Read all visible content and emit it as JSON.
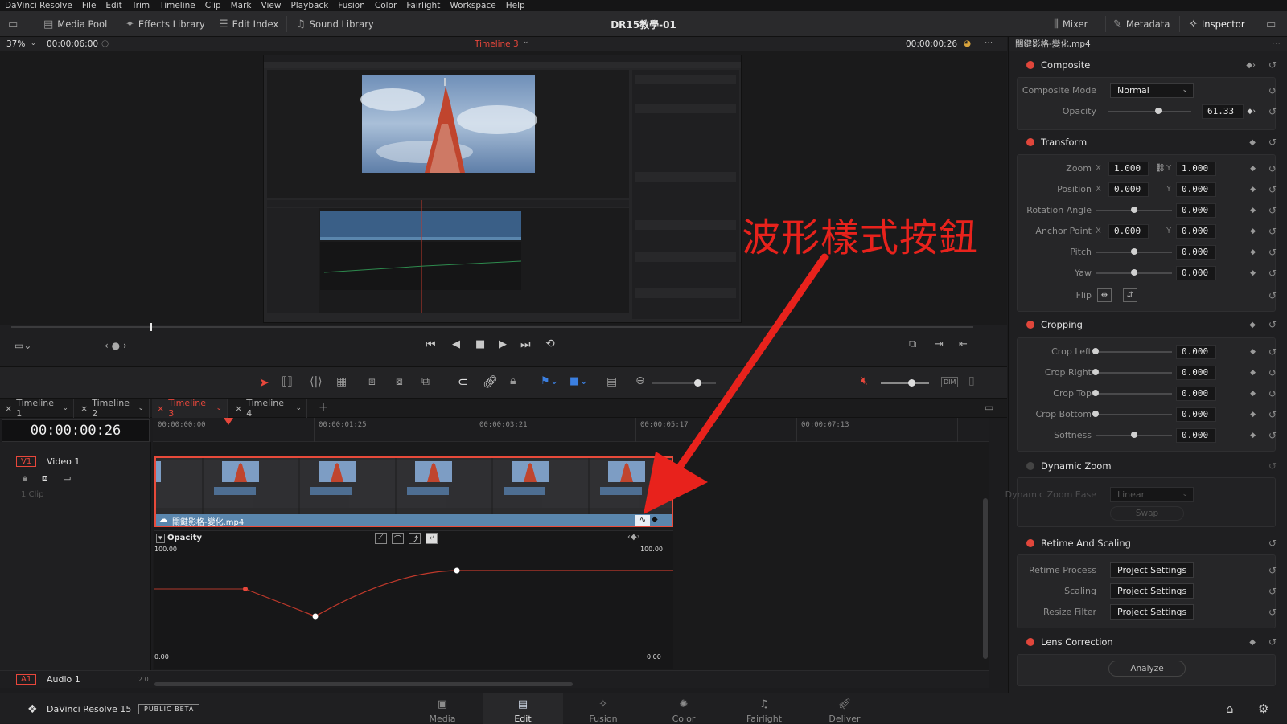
{
  "menubar": {
    "app": "DaVinci Resolve",
    "items": [
      "File",
      "Edit",
      "Trim",
      "Timeline",
      "Clip",
      "Mark",
      "View",
      "Playback",
      "Fusion",
      "Color",
      "Fairlight",
      "Workspace",
      "Help"
    ]
  },
  "toolbar": {
    "media_pool": "Media Pool",
    "effects_library": "Effects Library",
    "edit_index": "Edit Index",
    "sound_library": "Sound Library",
    "project_title": "DR15教學-01",
    "mixer": "Mixer",
    "metadata": "Metadata",
    "inspector": "Inspector"
  },
  "viewer": {
    "zoom": "37%",
    "source_timecode": "00:00:06:00",
    "timeline_name": "Timeline 3",
    "record_timecode": "00:00:00:26"
  },
  "timeline": {
    "tabs": [
      "Timeline 1",
      "Timeline 2",
      "Timeline 3",
      "Timeline 4"
    ],
    "active_tab": "Timeline 3",
    "current_timecode": "00:00:00:26",
    "ruler_ticks": [
      "00:00:00:00",
      "00:00:01:25",
      "00:00:03:21",
      "00:00:05:17",
      "00:00:07:13"
    ],
    "video_track": {
      "id": "V1",
      "name": "Video 1",
      "clips_count": "1 Clip"
    },
    "clip_name": "關鍵影格-變化.mp4",
    "curve": {
      "label": "Opacity",
      "top_left": "100.00",
      "top_right": "100.00",
      "bottom_left": "0.00",
      "bottom_right": "0.00"
    },
    "audio_track": {
      "id": "A1",
      "name": "Audio 1",
      "level": "2.0"
    }
  },
  "annotation": {
    "text": "波形樣式按鈕",
    "color": "#e8221c"
  },
  "inspector": {
    "clip_file": "關鍵影格-變化.mp4",
    "composite": {
      "title": "Composite",
      "mode_label": "Composite Mode",
      "mode_value": "Normal",
      "opacity_label": "Opacity",
      "opacity_value": "61.33"
    },
    "transform": {
      "title": "Transform",
      "zoom_label": "Zoom",
      "zoom_x": "1.000",
      "zoom_y": "1.000",
      "position_label": "Position",
      "position_x": "0.000",
      "position_y": "0.000",
      "rotation_label": "Rotation Angle",
      "rotation_value": "0.000",
      "anchor_label": "Anchor Point",
      "anchor_x": "0.000",
      "anchor_y": "0.000",
      "pitch_label": "Pitch",
      "pitch_value": "0.000",
      "yaw_label": "Yaw",
      "yaw_value": "0.000",
      "flip_label": "Flip"
    },
    "cropping": {
      "title": "Cropping",
      "left_label": "Crop Left",
      "left_value": "0.000",
      "right_label": "Crop Right",
      "right_value": "0.000",
      "top_label": "Crop Top",
      "top_value": "0.000",
      "bottom_label": "Crop Bottom",
      "bottom_value": "0.000",
      "softness_label": "Softness",
      "softness_value": "0.000"
    },
    "dynamic_zoom": {
      "title": "Dynamic Zoom",
      "ease_label": "Dynamic Zoom Ease",
      "ease_value": "Linear",
      "swap": "Swap"
    },
    "retime": {
      "title": "Retime And Scaling",
      "process_label": "Retime Process",
      "process_value": "Project Settings",
      "scaling_label": "Scaling",
      "scaling_value": "Project Settings",
      "resize_label": "Resize Filter",
      "resize_value": "Project Settings"
    },
    "lens": {
      "title": "Lens Correction",
      "analyze": "Analyze"
    }
  },
  "pagebar": {
    "app_name": "DaVinci Resolve 15",
    "badge": "PUBLIC BETA",
    "pages": [
      "Media",
      "Edit",
      "Fusion",
      "Color",
      "Fairlight",
      "Deliver"
    ],
    "active_page": "Edit"
  }
}
